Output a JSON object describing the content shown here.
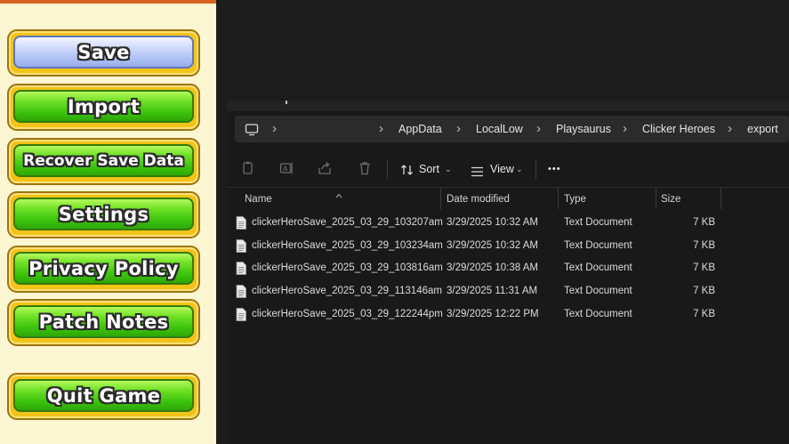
{
  "menu": {
    "buttons": [
      {
        "label": "Save",
        "style": "blue"
      },
      {
        "label": "Import",
        "style": "green"
      },
      {
        "label": "Recover Save Data",
        "style": "green"
      },
      {
        "label": "Settings",
        "style": "green"
      },
      {
        "label": "Privacy Policy",
        "style": "green"
      },
      {
        "label": "Patch Notes",
        "style": "green"
      },
      {
        "label": "Quit Game",
        "style": "green"
      }
    ]
  },
  "explorer": {
    "breadcrumb": [
      "AppData",
      "LocalLow",
      "Playsaurus",
      "Clicker Heroes",
      "export"
    ],
    "toolbar": {
      "sort_label": "Sort",
      "view_label": "View",
      "more_label": "•••"
    },
    "columns": [
      "Name",
      "Date modified",
      "Type",
      "Size"
    ],
    "files": [
      {
        "name": "clickerHeroSave_2025_03_29_103207am",
        "date": "3/29/2025 10:32 AM",
        "type": "Text Document",
        "size": "7 KB"
      },
      {
        "name": "clickerHeroSave_2025_03_29_103234am",
        "date": "3/29/2025 10:32 AM",
        "type": "Text Document",
        "size": "7 KB"
      },
      {
        "name": "clickerHeroSave_2025_03_29_103816am",
        "date": "3/29/2025 10:38 AM",
        "type": "Text Document",
        "size": "7 KB"
      },
      {
        "name": "clickerHeroSave_2025_03_29_113146am",
        "date": "3/29/2025 11:31 AM",
        "type": "Text Document",
        "size": "7 KB"
      },
      {
        "name": "clickerHeroSave_2025_03_29_122244pm",
        "date": "3/29/2025 12:22 PM",
        "type": "Text Document",
        "size": "7 KB"
      }
    ]
  },
  "colors": {
    "menu_background": "#fdf6d2",
    "button_rim": "#f2c418",
    "button_green": "#3cc40c",
    "button_blue": "#acbff4",
    "explorer_background": "#191919"
  }
}
